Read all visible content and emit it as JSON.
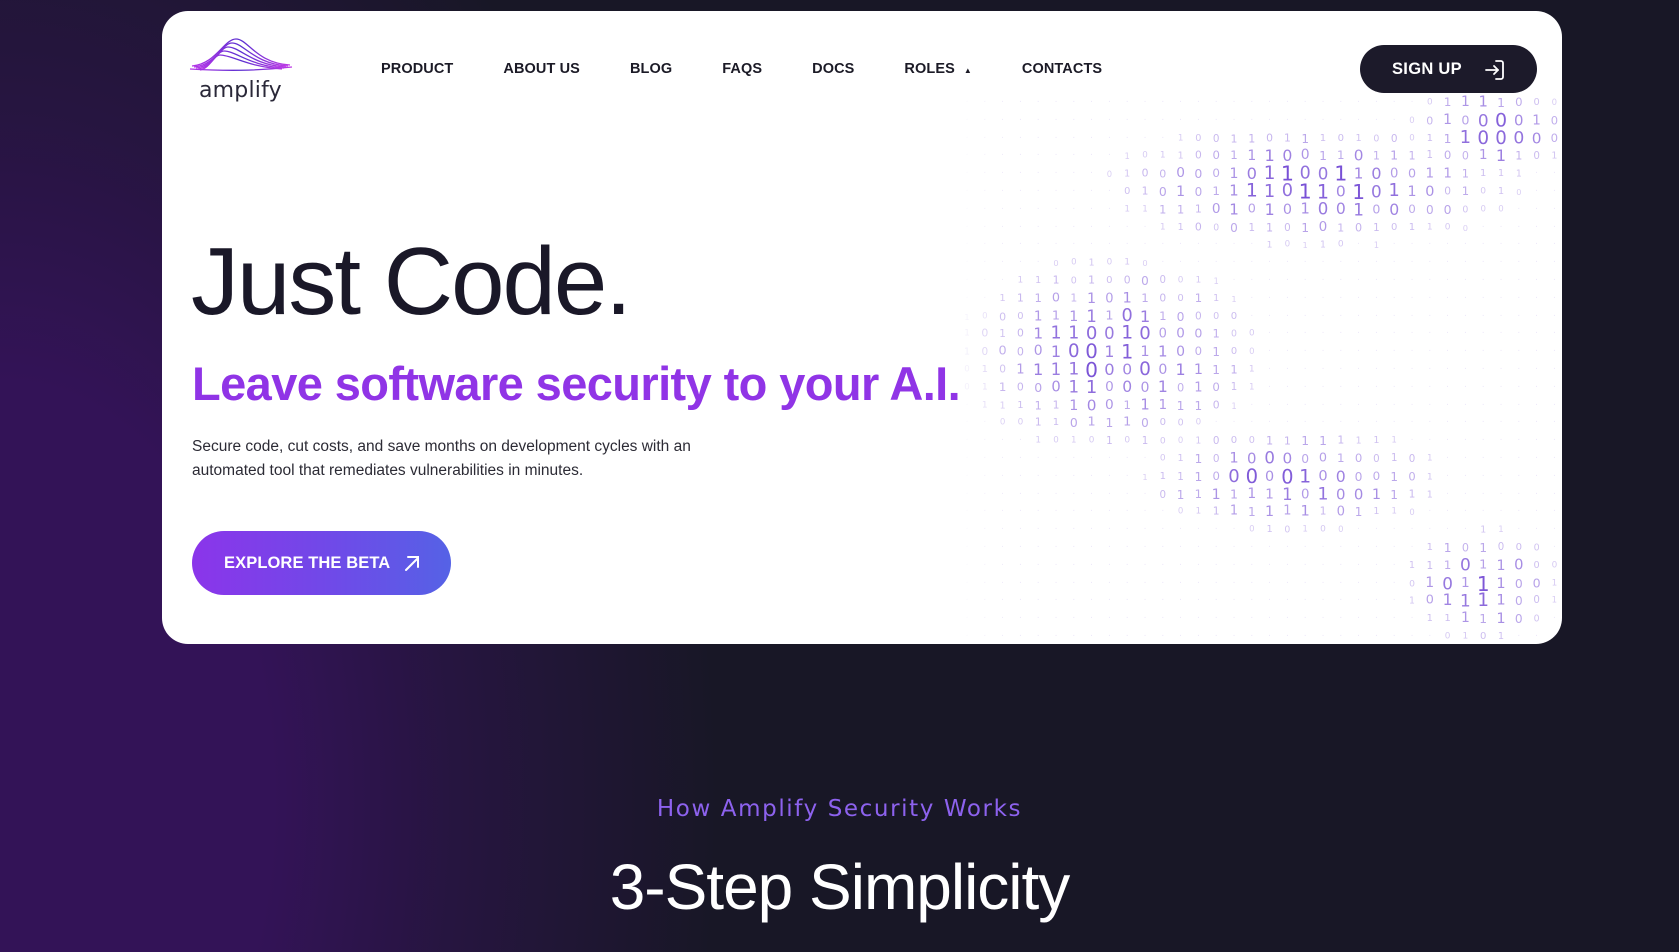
{
  "brand": {
    "name": "amplify",
    "logo_icon": "wave-peaks-icon",
    "colors": {
      "accent_purple": "#9034e6",
      "eyebrow_purple": "#8d62ee",
      "dark": "#1c1a2a",
      "page_bg": "#181726",
      "page_glow": "#331357",
      "cta_gradient_start": "#8b35ea",
      "cta_gradient_end": "#5562e6",
      "binary_purple": "#6b3fd2"
    }
  },
  "nav": {
    "items": [
      {
        "label": "PRODUCT"
      },
      {
        "label": "ABOUT US"
      },
      {
        "label": "BLOG"
      },
      {
        "label": "FAQS"
      },
      {
        "label": "DOCS"
      },
      {
        "label": "ROLES",
        "icon": "caret-up-icon"
      },
      {
        "label": "CONTACTS"
      }
    ]
  },
  "signup": {
    "label": "SIGN UP",
    "icon": "sign-in-icon"
  },
  "hero": {
    "title": "Just Code.",
    "subtitle": "Leave software security to your A.I.",
    "description": "Secure code, cut costs, and save months on development cycles with an automated tool that remediates vulnerabilities in minutes.",
    "cta": {
      "label": "EXPLORE THE BETA",
      "icon": "arrow-up-right-icon"
    },
    "decoration": "binary-digits-pattern"
  },
  "section": {
    "eyebrow": "How Amplify Security Works",
    "title": "3-Step Simplicity"
  }
}
